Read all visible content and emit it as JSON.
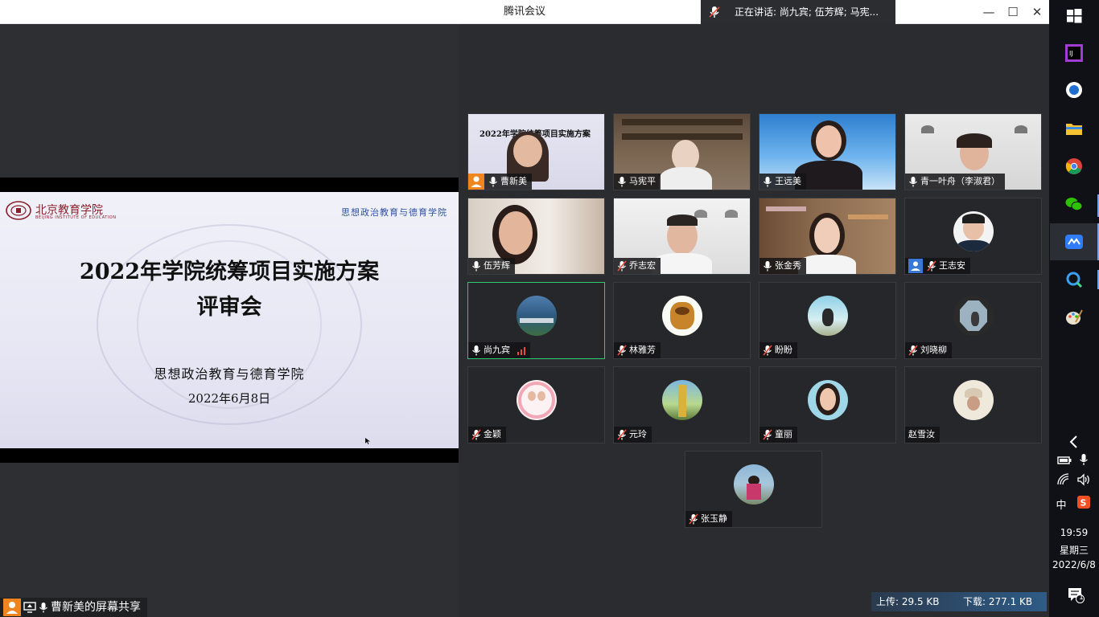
{
  "window": {
    "title": "腾讯会议",
    "speaking": "正在讲话: 尚九宾; 伍芳辉; 马宪..."
  },
  "slide": {
    "logo_text": "北京教育学院",
    "logo_sub": "BEIJING INSTITUTE OF EDUCATION",
    "dept_top": "思想政治教育与德育学院",
    "title_line1": "2022年学院统筹项目实施方案",
    "title_line2": "评审会",
    "dept": "思想政治教育与德育学院",
    "date": "2022年6月8日"
  },
  "share_label": "曹新美的屏幕共享",
  "participants": [
    {
      "name": "曹新美",
      "host": true,
      "mic": "on"
    },
    {
      "name": "马宪平",
      "mic": "on"
    },
    {
      "name": "王远美",
      "mic": "on"
    },
    {
      "name": "青一叶舟（李淑君）",
      "mic": "on"
    },
    {
      "name": "伍芳辉",
      "mic": "on"
    },
    {
      "name": "乔志宏",
      "mic": "muted"
    },
    {
      "name": "张金秀",
      "mic": "on"
    },
    {
      "name": "王志安",
      "user_icon": true,
      "mic": "muted"
    },
    {
      "name": "尚九宾",
      "mic": "on",
      "speaking": true
    },
    {
      "name": "林雅芳",
      "mic": "muted"
    },
    {
      "name": "盼盼",
      "mic": "muted"
    },
    {
      "name": "刘晓柳",
      "mic": "muted"
    },
    {
      "name": "金颖",
      "mic": "muted"
    },
    {
      "name": "元玲",
      "mic": "muted"
    },
    {
      "name": "童丽",
      "mic": "muted"
    },
    {
      "name": "赵雪汝",
      "mic": "none"
    },
    {
      "name": "张玉静",
      "mic": "muted"
    }
  ],
  "network": {
    "upload": "上传: 29.5 KB",
    "download": "下载: 277.1 KB"
  },
  "tray": {
    "ime": "中",
    "time": "19:59",
    "weekday": "星期三",
    "date": "2022/6/8",
    "notifications": "1"
  },
  "colors": {
    "active_border": "#2ecc71",
    "host_badge": "#f0841e",
    "muted_red": "#e74c3c"
  }
}
